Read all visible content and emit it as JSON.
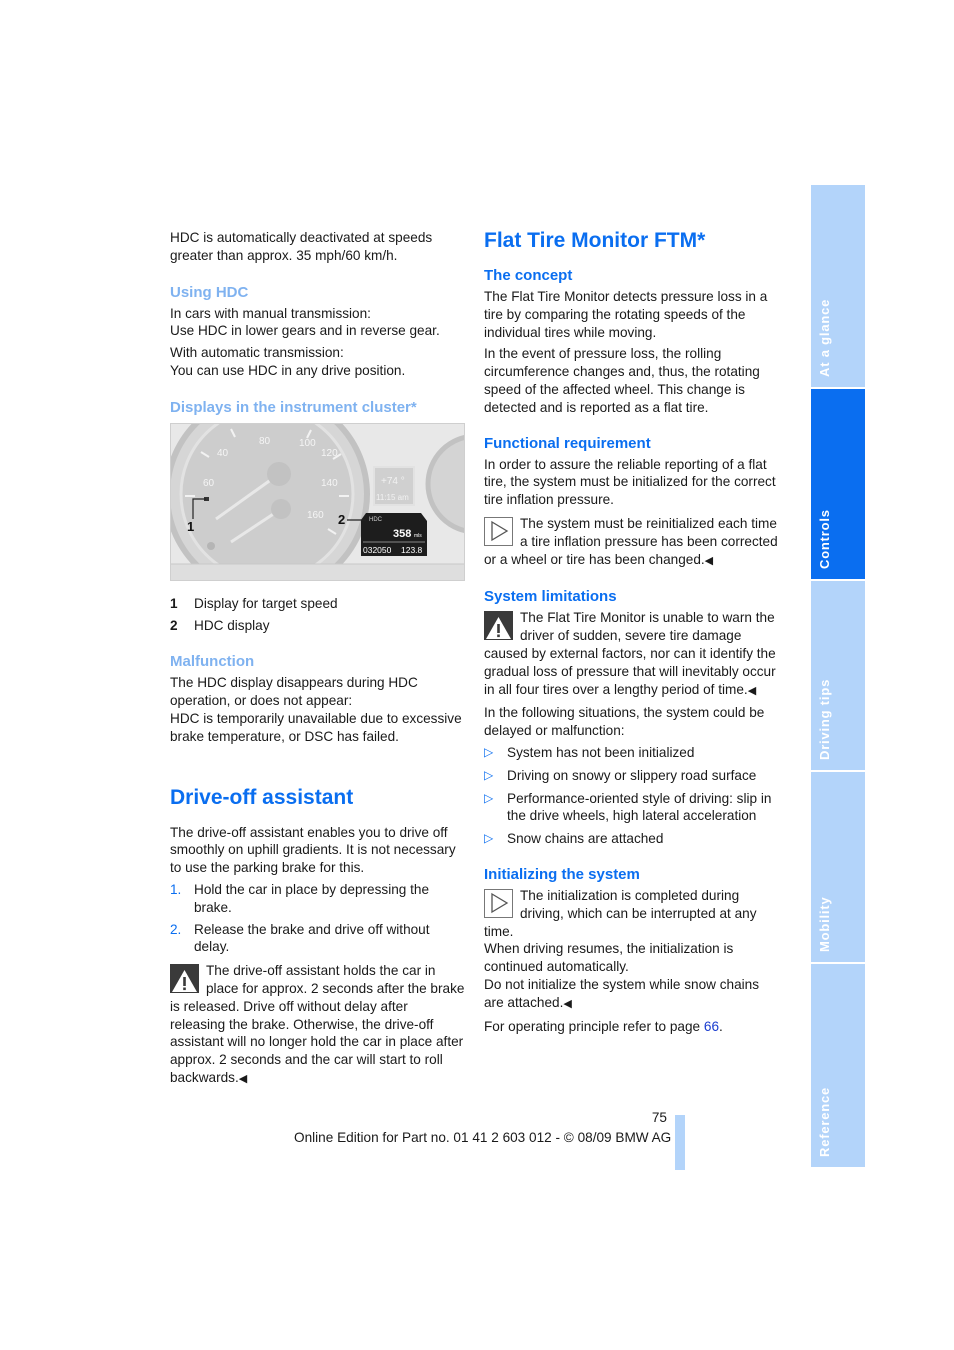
{
  "left_column": {
    "intro": "HDC is automatically deactivated at speeds greater than approx. 35 mph/60 km/h.",
    "using_hdc": {
      "heading": "Using HDC",
      "manual_1": "In cars with manual transmission:",
      "manual_2": "Use HDC in lower gears and in reverse gear.",
      "auto_1": "With automatic transmission:",
      "auto_2": "You can use HDC in any drive position."
    },
    "displays": {
      "heading": "Displays in the instrument cluster*",
      "figure": {
        "callout_1": "1",
        "callout_2": "2",
        "display_label": "HDC",
        "range_value": "358",
        "range_unit": "mls",
        "odometer": "032050",
        "trip": "123.8",
        "temp": "+74 °",
        "clock": "11:15 am",
        "gauge_labels": [
          "40",
          "60",
          "80",
          "100",
          "120",
          "140",
          "160"
        ]
      },
      "legend": [
        {
          "num": "1",
          "text": "Display for target speed"
        },
        {
          "num": "2",
          "text": "HDC display"
        }
      ]
    },
    "malfunction": {
      "heading": "Malfunction",
      "text_1": "The HDC display disappears during HDC operation, or does not appear:",
      "text_2": "HDC is temporarily unavailable due to excessive brake temperature, or DSC has failed."
    },
    "drive_off": {
      "heading": "Drive-off assistant",
      "intro": "The drive-off assistant enables you to drive off smoothly on uphill gradients. It is not necessary to use the parking brake for this.",
      "steps": [
        {
          "num": "1.",
          "text": "Hold the car in place by depressing the brake."
        },
        {
          "num": "2.",
          "text": "Release the brake and drive off without delay."
        }
      ],
      "warning": "The drive-off assistant holds the car in place for approx. 2 seconds after the brake is released. Drive off without delay after releasing the brake. Otherwise, the drive-off assistant will no longer hold the car in place after approx. 2 seconds and the car will start to roll backwards."
    }
  },
  "right_column": {
    "title": "Flat Tire Monitor FTM*",
    "concept": {
      "heading": "The concept",
      "p1": "The Flat Tire Monitor detects pressure loss in a tire by comparing the rotating speeds of the individual tires while moving.",
      "p2": "In the event of pressure loss, the rolling circumference changes and, thus, the rotating speed of the affected wheel. This change is detected and is reported as a flat tire."
    },
    "functional": {
      "heading": "Functional requirement",
      "p1": "In order to assure the reliable reporting of a flat tire, the system must be initialized for the correct tire inflation pressure.",
      "note": "The system must be reinitialized each time a tire inflation pressure has been corrected or a wheel or tire has been changed."
    },
    "limitations": {
      "heading": "System limitations",
      "warning": "The Flat Tire Monitor is unable to warn the driver of sudden, severe tire damage caused by external factors, nor can it identify the gradual loss of pressure that will inevitably occur in all four tires over a lengthy period of time.",
      "intro": "In the following situations, the system could be delayed or malfunction:",
      "bullets": [
        "System has not been initialized",
        "Driving on snowy or slippery road surface",
        "Performance-oriented style of driving: slip in the drive wheels, high lateral acceleration",
        "Snow chains are attached"
      ]
    },
    "initializing": {
      "heading": "Initializing the system",
      "note_1": "The initialization is completed during driving, which can be interrupted at any time.",
      "note_2": "When driving resumes, the initialization is continued automatically.",
      "note_3": "Do not initialize the system while snow chains are attached.",
      "ref_text": "For operating principle refer to page ",
      "ref_page": "66",
      "ref_end": "."
    }
  },
  "side_tabs": [
    {
      "label": "At a glance",
      "active": false
    },
    {
      "label": "Controls",
      "active": true
    },
    {
      "label": "Driving tips",
      "active": false
    },
    {
      "label": "Mobility",
      "active": false
    },
    {
      "label": "Reference",
      "active": false
    }
  ],
  "footer": {
    "page_number": "75",
    "edition": "Online Edition for Part no. 01 41 2 603 012 - © 08/09 BMW AG"
  },
  "symbols": {
    "end_mark": "◀",
    "bullet": "▷"
  },
  "colors": {
    "heading_blue": "#0a6ef0",
    "heading_light": "#7fb2f0",
    "tab_inactive": "#b3d4fa",
    "tab_active": "#0a6ef0"
  }
}
